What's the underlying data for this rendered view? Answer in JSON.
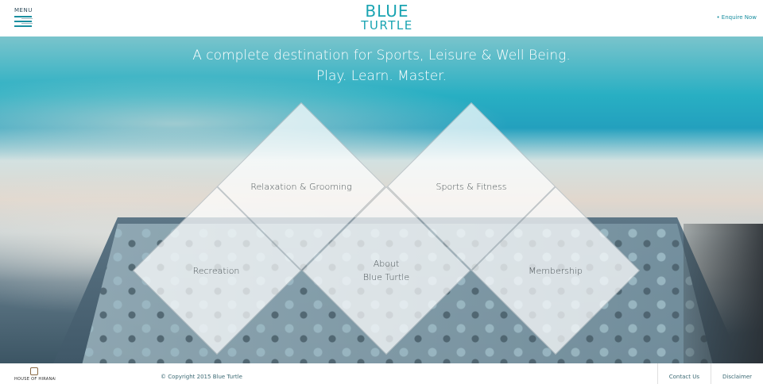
{
  "header": {
    "menu_label": "MENU",
    "logo_line1": "BLUE",
    "logo_line2": "TURTLE",
    "enquire_label": "• Enquire Now"
  },
  "hero": {
    "tagline_line1": "A complete destination for Sports, Leisure & Well Being.",
    "tagline_line2": "Play. Learn. Master."
  },
  "diamonds": [
    {
      "label": "Relaxation & Grooming"
    },
    {
      "label": "Sports & Fitness"
    },
    {
      "label": "Recreation"
    },
    {
      "label_line1": "About",
      "label_line2": "Blue Turtle"
    },
    {
      "label": "Membership"
    }
  ],
  "footer": {
    "partner_logo_text": "HOUSE OF HIRANANDANI",
    "copyright": "© Copyright 2015 Blue Turtle",
    "links": [
      "Contact Us",
      "Disclaimer"
    ]
  },
  "colors": {
    "brand": "#1aa4b2",
    "link": "#3c6a74"
  }
}
